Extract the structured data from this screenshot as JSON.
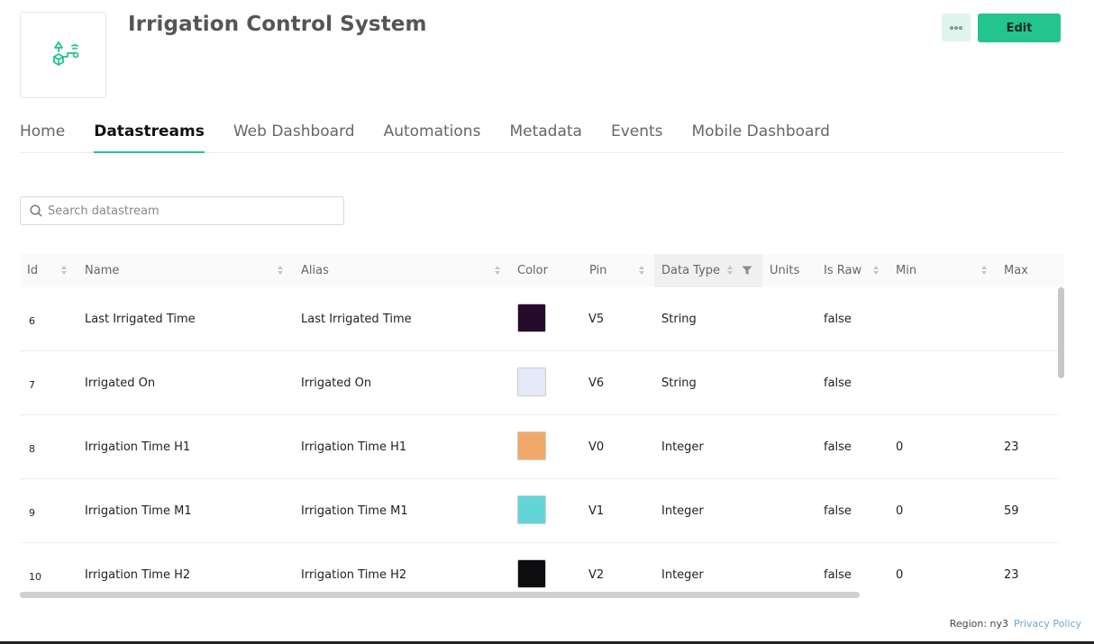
{
  "header": {
    "title": "Irrigation Control System",
    "edit_label": "Edit",
    "more_icon": "ellipsis-icon",
    "logo_icon": "irrigation-device-icon"
  },
  "tabs": [
    {
      "label": "Home",
      "active": false
    },
    {
      "label": "Datastreams",
      "active": true
    },
    {
      "label": "Web Dashboard",
      "active": false
    },
    {
      "label": "Automations",
      "active": false
    },
    {
      "label": "Metadata",
      "active": false
    },
    {
      "label": "Events",
      "active": false
    },
    {
      "label": "Mobile Dashboard",
      "active": false
    }
  ],
  "search": {
    "placeholder": "Search datastream",
    "value": ""
  },
  "table": {
    "columns": [
      "Id",
      "Name",
      "Alias",
      "Color",
      "Pin",
      "Data Type",
      "Units",
      "Is Raw",
      "Min",
      "Max"
    ],
    "rows": [
      {
        "id": "6",
        "name": "Last Irrigated Time",
        "alias": "Last Irrigated Time",
        "color": "#260a2d",
        "pin": "V5",
        "type": "String",
        "units": "",
        "raw": "false",
        "min": "",
        "max": ""
      },
      {
        "id": "7",
        "name": "Irrigated On",
        "alias": "Irrigated On",
        "color": "#e4e8f7",
        "pin": "V6",
        "type": "String",
        "units": "",
        "raw": "false",
        "min": "",
        "max": ""
      },
      {
        "id": "8",
        "name": "Irrigation Time H1",
        "alias": "Irrigation Time H1",
        "color": "#f1a96a",
        "pin": "V0",
        "type": "Integer",
        "units": "",
        "raw": "false",
        "min": "0",
        "max": "23"
      },
      {
        "id": "9",
        "name": "Irrigation Time M1",
        "alias": "Irrigation Time M1",
        "color": "#62d6d6",
        "pin": "V1",
        "type": "Integer",
        "units": "",
        "raw": "false",
        "min": "0",
        "max": "59"
      },
      {
        "id": "10",
        "name": "Irrigation Time H2",
        "alias": "Irrigation Time H2",
        "color": "#0e0d10",
        "pin": "V2",
        "type": "Integer",
        "units": "",
        "raw": "false",
        "min": "0",
        "max": "23"
      }
    ]
  },
  "footer": {
    "region": "Region: ny3",
    "privacy": "Privacy Policy"
  },
  "colors": {
    "accent": "#23c48e"
  }
}
